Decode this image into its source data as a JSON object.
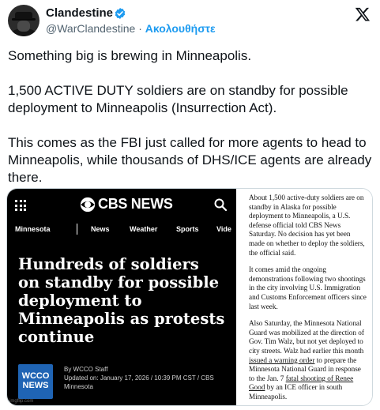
{
  "tweet": {
    "author_name": "Clandestine",
    "handle": "@WarClandestine",
    "separator": "·",
    "follow_label": "Ακολουθήστε",
    "paragraphs": [
      "Something big is brewing in Minneapolis.",
      "1,500 ACTIVE DUTY soldiers are on standby for possible deployment to Minneapolis (Insurrection Act).",
      "This comes as the FBI just called for more agents to head to Minneapolis, while thousands of DHS/ICE agents are already there."
    ],
    "colors": {
      "accent": "#1d9bf0",
      "text": "#0f1419",
      "muted": "#536471"
    },
    "icons": {
      "verified": "verified-badge-icon",
      "platform": "x-logo-icon"
    }
  },
  "cbs": {
    "logo_text": "CBS NEWS",
    "nav": {
      "section": "Minnesota",
      "items": [
        "News",
        "Weather",
        "Sports",
        "Vide"
      ]
    },
    "headline": "Hundreds of soldiers on standby for possible deployment to Minneapolis as protests continue",
    "station_logo": [
      "WCCO",
      "NEWS"
    ],
    "byline": [
      "By WCCO Staff",
      "Updated on: January 17, 2026 / 10:39 PM CST / CBS",
      "Minnesota"
    ],
    "watermark": "imgflip.com",
    "colors": {
      "background": "#000000",
      "station": "#1f64b4"
    }
  },
  "article": {
    "p1": "About 1,500 active-duty soldiers are on standby in Alaska for possible deployment to Minneapolis, a U.S. defense official told CBS News Saturday. No decision has yet been made on whether to deploy the soldiers, the official said.",
    "p2": "It comes amid the ongoing demonstrations following two shootings in the city involving U.S. Immigration and Customs Enforcement officers since last week.",
    "p3_a": "Also Saturday, the Minnesota National Guard was mobilized at the direction of Gov. Tim Walz, but not yet deployed to city streets. Walz had earlier this month ",
    "p3_link1": "issued a warning order",
    "p3_b": " to prepare the Minnesota National Guard in response to the Jan. 7 ",
    "p3_link2": "fatal shooting of Renee Good",
    "p3_c": " by an ICE officer in south Minneapolis."
  }
}
